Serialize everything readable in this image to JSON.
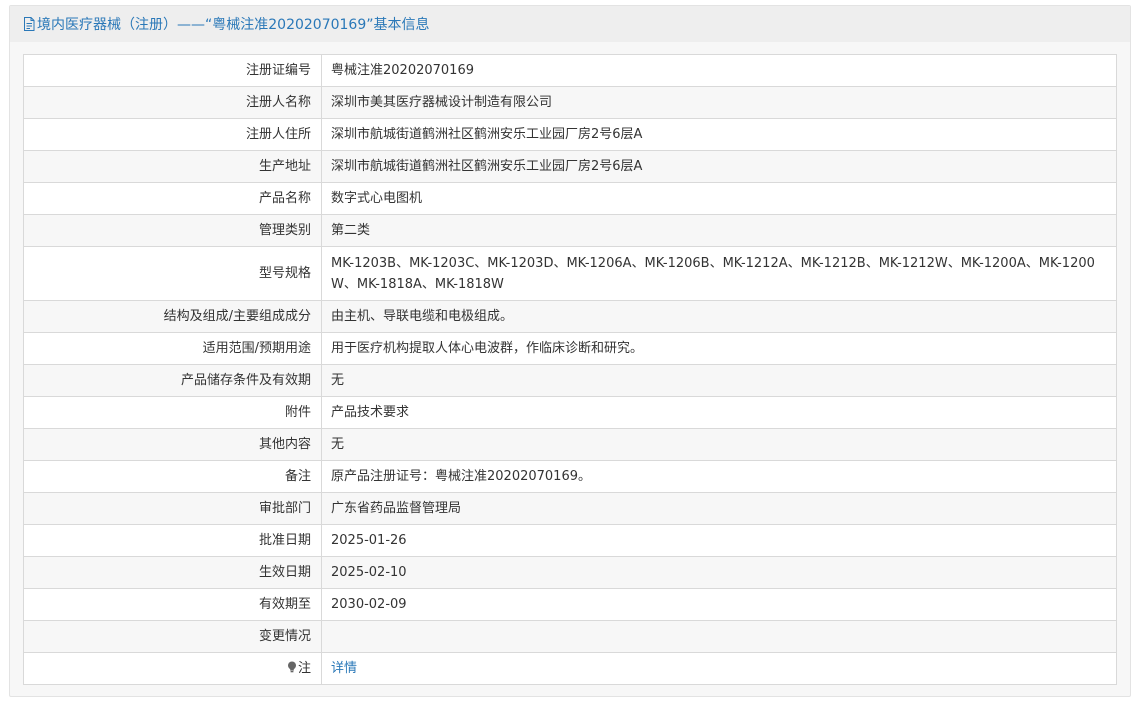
{
  "header": {
    "title": "境内医疗器械（注册）——“粤械注准20202070169”基本信息"
  },
  "rows": [
    {
      "label": "注册证编号",
      "value": "粤械注准20202070169"
    },
    {
      "label": "注册人名称",
      "value": "深圳市美其医疗器械设计制造有限公司"
    },
    {
      "label": "注册人住所",
      "value": "深圳市航城街道鹤洲社区鹤洲安乐工业园厂房2号6层A"
    },
    {
      "label": "生产地址",
      "value": "深圳市航城街道鹤洲社区鹤洲安乐工业园厂房2号6层A"
    },
    {
      "label": "产品名称",
      "value": "数字式心电图机"
    },
    {
      "label": "管理类别",
      "value": "第二类"
    },
    {
      "label": "型号规格",
      "value": "MK-1203B、MK-1203C、MK-1203D、MK-1206A、MK-1206B、MK-1212A、MK-1212B、MK-1212W、MK-1200A、MK-1200W、MK-1818A、MK-1818W"
    },
    {
      "label": "结构及组成/主要组成成分",
      "value": "由主机、导联电缆和电极组成。"
    },
    {
      "label": "适用范围/预期用途",
      "value": "用于医疗机构提取人体心电波群，作临床诊断和研究。"
    },
    {
      "label": "产品储存条件及有效期",
      "value": "无"
    },
    {
      "label": "附件",
      "value": "产品技术要求"
    },
    {
      "label": "其他内容",
      "value": "无"
    },
    {
      "label": "备注",
      "value": "原产品注册证号：粤械注准20202070169。"
    },
    {
      "label": "审批部门",
      "value": "广东省药品监督管理局"
    },
    {
      "label": "批准日期",
      "value": "2025-01-26"
    },
    {
      "label": "生效日期",
      "value": "2025-02-10"
    },
    {
      "label": "有效期至",
      "value": "2030-02-09"
    },
    {
      "label": "变更情况",
      "value": ""
    }
  ],
  "note_row": {
    "label": "注",
    "link": "详情",
    "icon": "bulb-icon"
  }
}
